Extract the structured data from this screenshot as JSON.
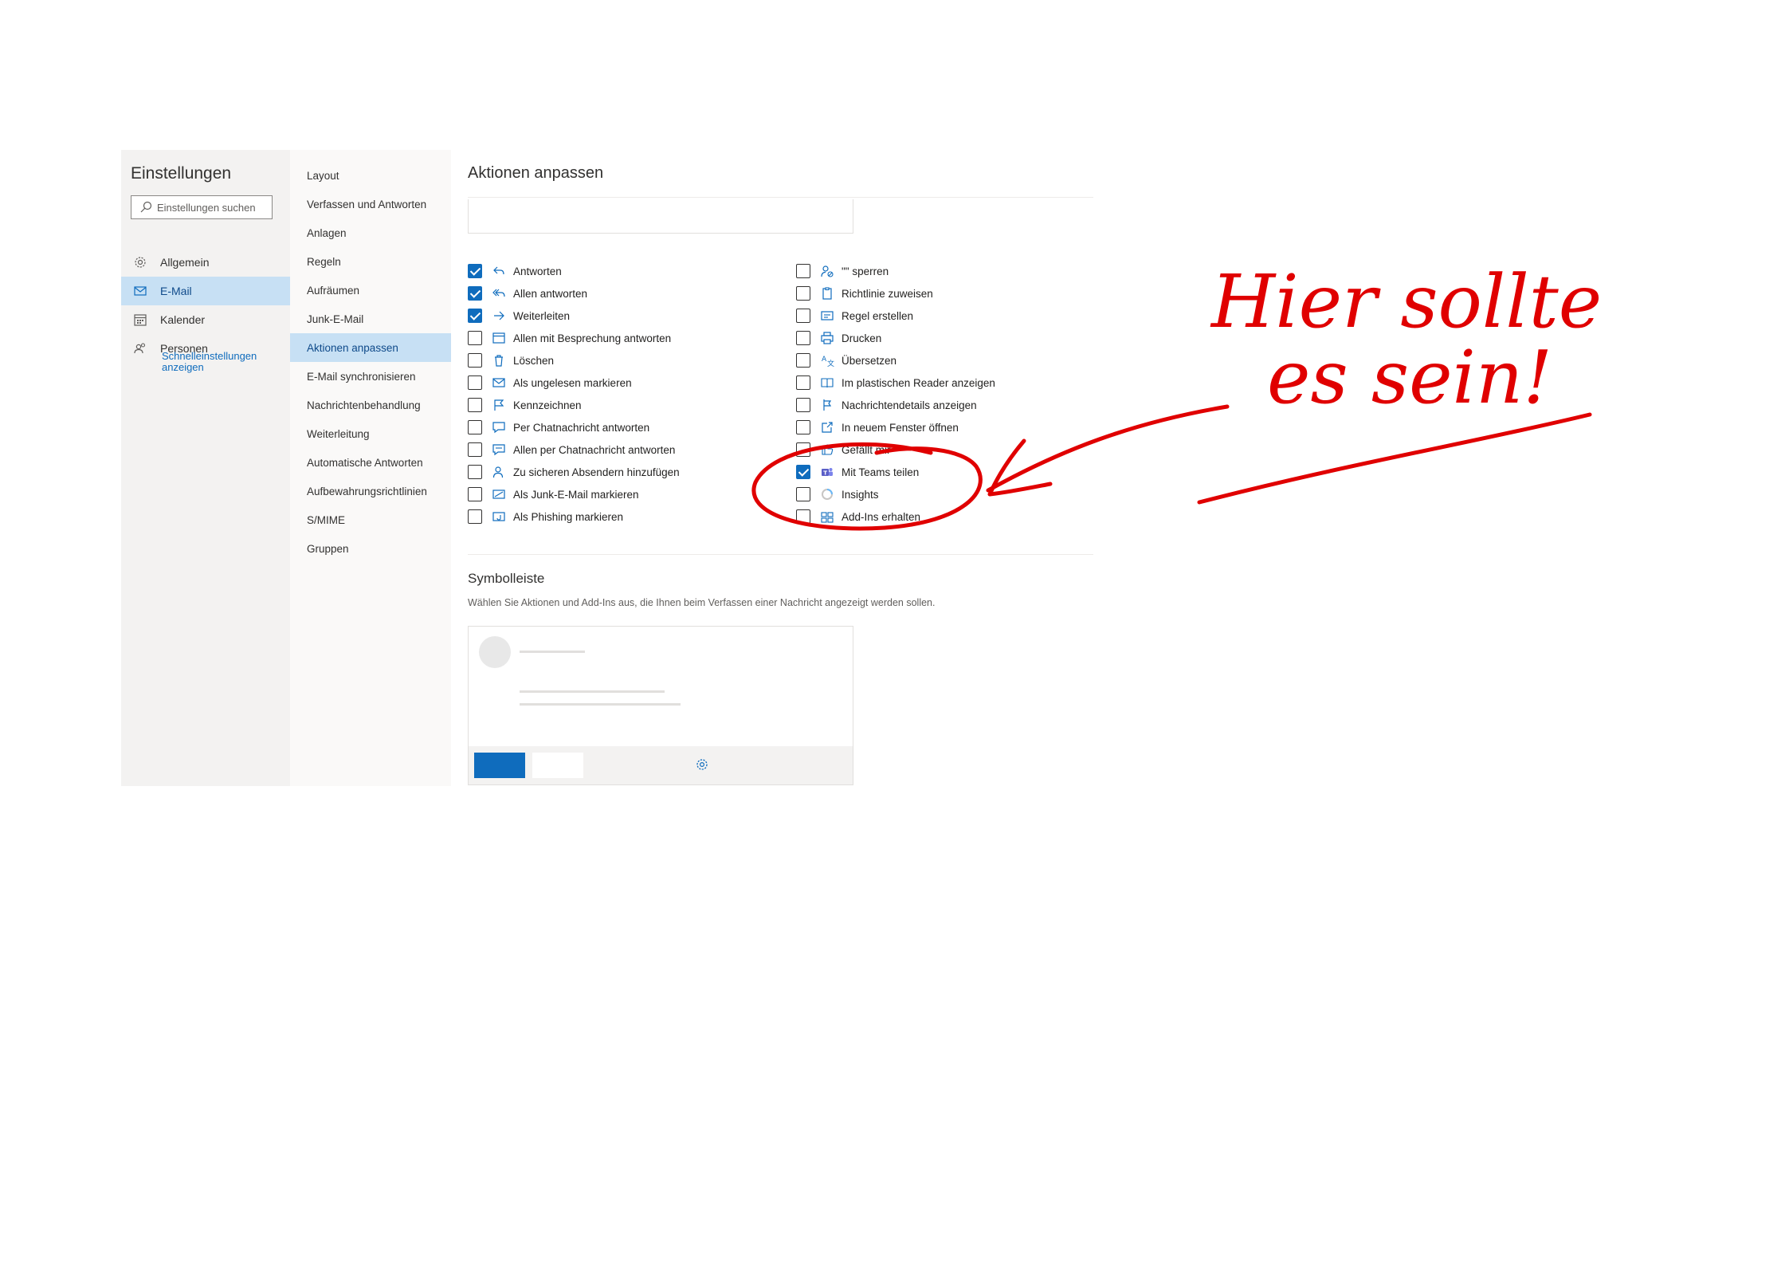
{
  "settings": {
    "title": "Einstellungen",
    "search_placeholder": "Einstellungen suchen",
    "categories": [
      {
        "label": "Allgemein",
        "icon": "gear-icon",
        "active": false
      },
      {
        "label": "E-Mail",
        "icon": "mail-icon",
        "active": true
      },
      {
        "label": "Kalender",
        "icon": "calendar-icon",
        "active": false
      },
      {
        "label": "Personen",
        "icon": "people-icon",
        "active": false
      }
    ],
    "quick_settings_link": "Schnelleinstellungen anzeigen"
  },
  "subnav": {
    "items": [
      "Layout",
      "Verfassen und Antworten",
      "Anlagen",
      "Regeln",
      "Aufräumen",
      "Junk-E-Mail",
      "Aktionen anpassen",
      "E-Mail synchronisieren",
      "Nachrichtenbehandlung",
      "Weiterleitung",
      "Automatische Antworten",
      "Aufbewahrungsrichtlinien",
      "S/MIME",
      "Gruppen"
    ],
    "active_index": 6
  },
  "main": {
    "title": "Aktionen anpassen",
    "actions_left": [
      {
        "label": "Antworten",
        "checked": true,
        "icon": "reply-icon"
      },
      {
        "label": "Allen antworten",
        "checked": true,
        "icon": "reply-all-icon"
      },
      {
        "label": "Weiterleiten",
        "checked": true,
        "icon": "forward-icon"
      },
      {
        "label": "Allen mit Besprechung antworten",
        "checked": false,
        "icon": "calendar-reply-icon"
      },
      {
        "label": "Löschen",
        "checked": false,
        "icon": "delete-icon"
      },
      {
        "label": "Als ungelesen markieren",
        "checked": false,
        "icon": "mail-unread-icon"
      },
      {
        "label": "Kennzeichnen",
        "checked": false,
        "icon": "flag-icon"
      },
      {
        "label": "Per Chatnachricht antworten",
        "checked": false,
        "icon": "chat-icon"
      },
      {
        "label": "Allen per Chatnachricht antworten",
        "checked": false,
        "icon": "chat-all-icon"
      },
      {
        "label": "Zu sicheren Absendern hinzufügen",
        "checked": false,
        "icon": "person-add-icon"
      },
      {
        "label": "Als Junk-E-Mail markieren",
        "checked": false,
        "icon": "junk-mail-icon"
      },
      {
        "label": "Als Phishing markieren",
        "checked": false,
        "icon": "phishing-icon"
      }
    ],
    "actions_right": [
      {
        "label": "\"\" sperren",
        "checked": false,
        "icon": "block-person-icon"
      },
      {
        "label": "Richtlinie zuweisen",
        "checked": false,
        "icon": "policy-icon"
      },
      {
        "label": "Regel erstellen",
        "checked": false,
        "icon": "rule-icon"
      },
      {
        "label": "Drucken",
        "checked": false,
        "icon": "print-icon"
      },
      {
        "label": "Übersetzen",
        "checked": false,
        "icon": "translate-icon"
      },
      {
        "label": "Im plastischen Reader anzeigen",
        "checked": false,
        "icon": "reader-icon"
      },
      {
        "label": "Nachrichtendetails anzeigen",
        "checked": false,
        "icon": "details-icon"
      },
      {
        "label": "In neuem Fenster öffnen",
        "checked": false,
        "icon": "open-window-icon"
      },
      {
        "label": "Gefällt mir",
        "checked": false,
        "icon": "like-icon"
      },
      {
        "label": "Mit Teams teilen",
        "checked": true,
        "icon": "teams-icon"
      },
      {
        "label": "Insights",
        "checked": false,
        "icon": "insights-icon"
      },
      {
        "label": "Add-Ins erhalten",
        "checked": false,
        "icon": "add-ins-icon"
      }
    ],
    "toolbar_section": {
      "title": "Symbolleiste",
      "description": "Wählen Sie Aktionen und Add-Ins aus, die Ihnen beim Verfassen einer Nachricht angezeigt werden sollen."
    }
  },
  "annotation": {
    "line1": "Hier sollte",
    "line2": "es sein!",
    "color": "#e00000"
  },
  "colors": {
    "accent": "#0f6cbd",
    "selected_bg": "#c7e0f4",
    "pane_bg": "#f3f2f1",
    "annotation": "#e00000"
  }
}
